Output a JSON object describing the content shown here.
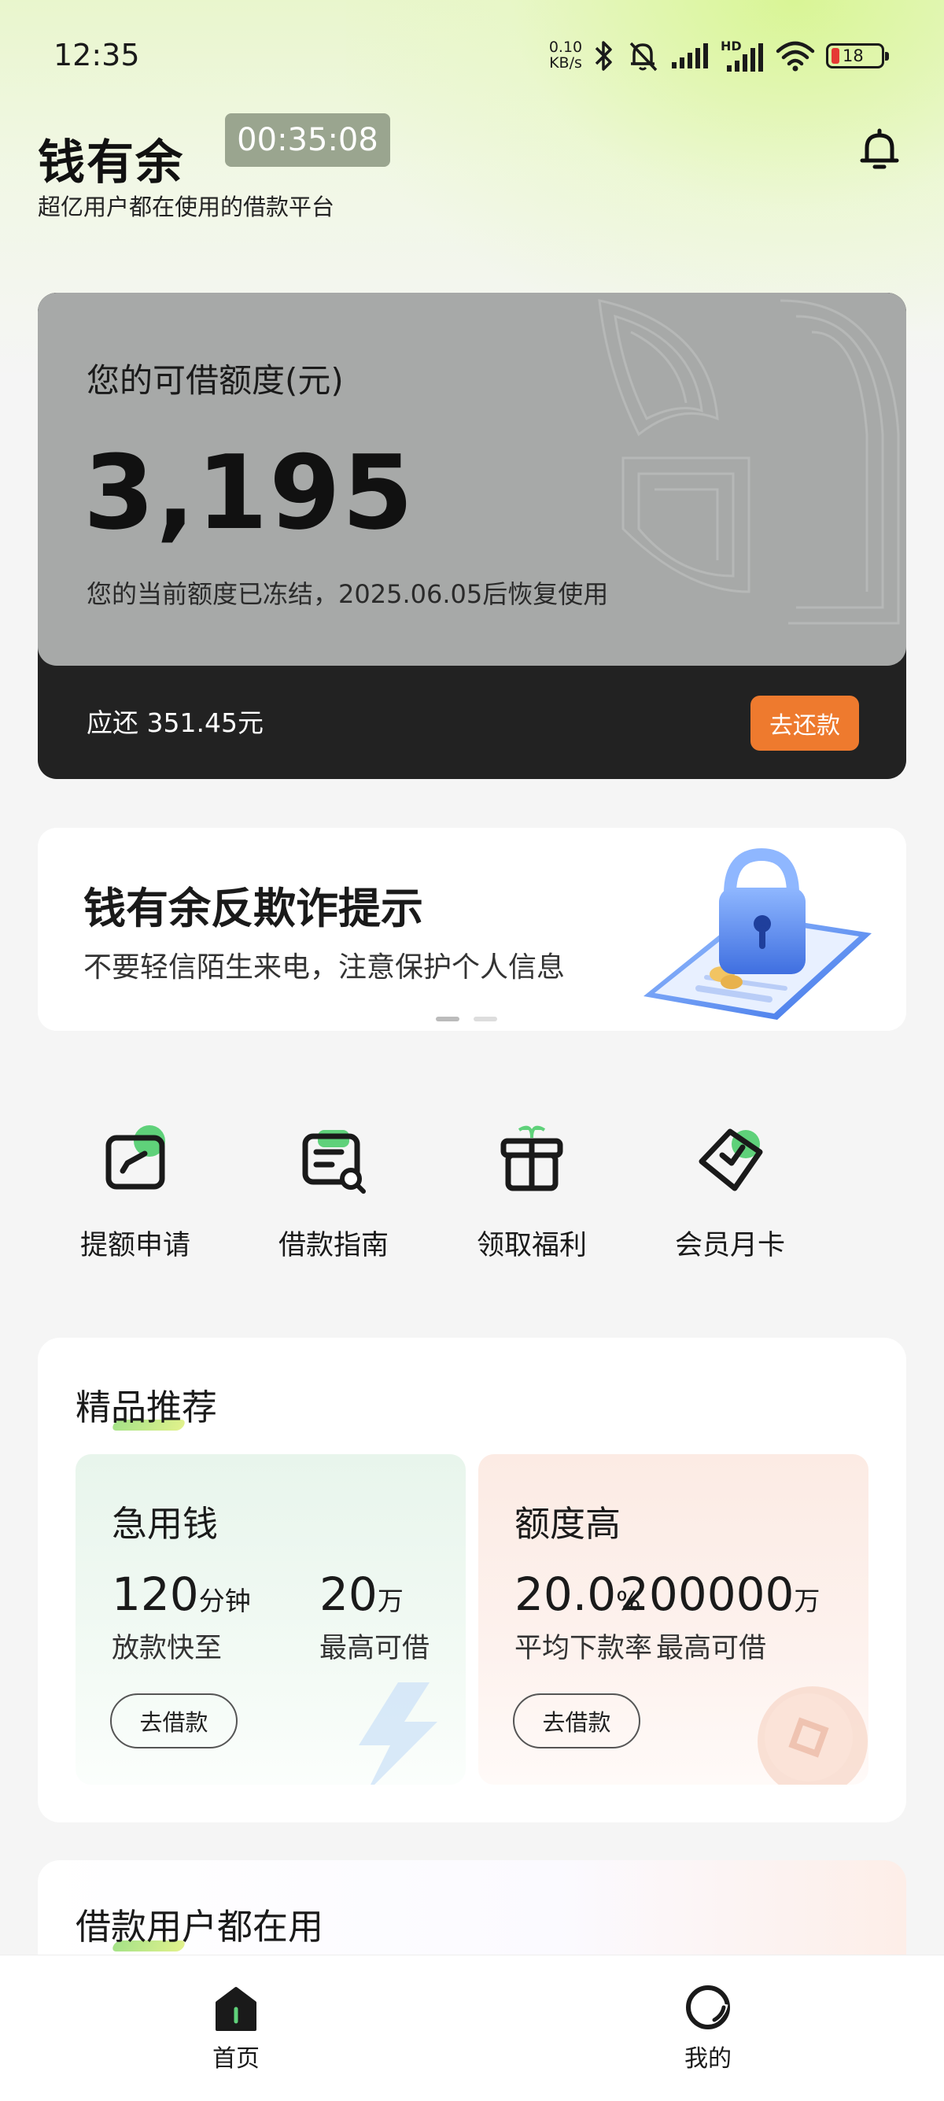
{
  "status_bar": {
    "time": "12:35",
    "net_speed_value": "0.10",
    "net_speed_unit": "KB/s",
    "signal_label": "HD",
    "battery": "18",
    "icons": [
      "bluetooth-icon",
      "mute-icon",
      "signal-icon",
      "signal-hd-icon",
      "wifi-icon",
      "battery-icon"
    ]
  },
  "header": {
    "title": "钱有余",
    "subtitle": "超亿用户都在使用的借款平台",
    "timer": "00:35:08",
    "bell_icon": "bell-icon"
  },
  "credit": {
    "label": "您的可借额度(元)",
    "amount": "3,195",
    "note": "您的当前额度已冻结，2025.06.05后恢复使用",
    "repay_text": "应还 351.45元",
    "repay_button": "去还款"
  },
  "banner": {
    "title": "钱有余反欺诈提示",
    "subtitle": "不要轻信陌生来电，注意保护个人信息",
    "slides": 2,
    "active_slide": 1
  },
  "quick_actions": [
    {
      "label": "提额申请",
      "icon": "credit-increase-icon"
    },
    {
      "label": "借款指南",
      "icon": "guide-icon"
    },
    {
      "label": "领取福利",
      "icon": "gift-icon"
    },
    {
      "label": "会员月卡",
      "icon": "member-card-icon"
    }
  ],
  "recommend": {
    "title": "精品推荐",
    "products": [
      {
        "name": "急用钱",
        "stat1_value": "120",
        "stat1_unit": "分钟",
        "stat1_caption": "放款快至",
        "stat2_value": "20",
        "stat2_unit": "万",
        "stat2_caption": "最高可借",
        "button": "去借款"
      },
      {
        "name": "额度高",
        "stat1_value": "20.0",
        "stat1_unit": "%",
        "stat1_caption": "平均下款率",
        "stat2_value": "200000",
        "stat2_unit": "万",
        "stat2_caption": "最高可借",
        "button": "去借款"
      }
    ]
  },
  "users_section": {
    "title": "借款用户都在用"
  },
  "bottom_nav": [
    {
      "label": "首页",
      "icon": "home-icon",
      "active": true
    },
    {
      "label": "我的",
      "icon": "profile-icon",
      "active": false
    }
  ],
  "colors": {
    "accent_orange": "#ee7a2e",
    "card_gray": "#a7a9a8",
    "card_dark": "#222222",
    "accent_green": "#5fd17a"
  }
}
